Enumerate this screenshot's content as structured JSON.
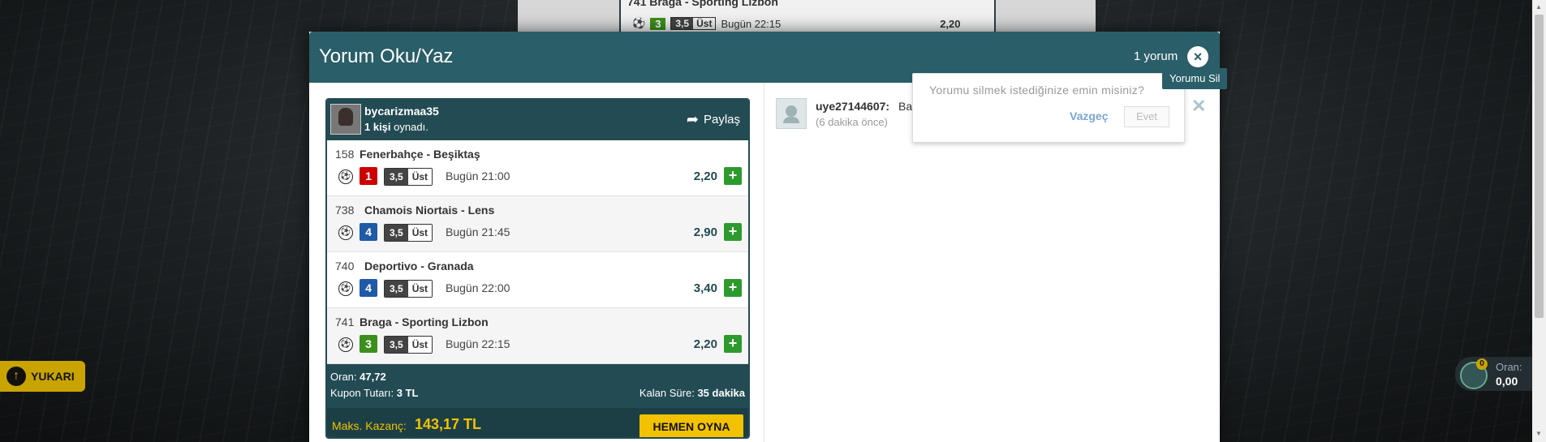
{
  "background": {
    "coupon_row": {
      "id": "741",
      "name": "Braga - Sporting Lizbon",
      "pick": "3",
      "market_a": "3,5",
      "market_b": "Üst",
      "time": "Bugün 22:15",
      "odd": "2,20"
    }
  },
  "left_button": {
    "label": "YUKARI"
  },
  "coupon_widget": {
    "count": "0",
    "label": "Oran:",
    "value": "0,00"
  },
  "modal": {
    "title": "Yorum Oku/Yaz",
    "count": "1 yorum",
    "close_icon": "×"
  },
  "coupon": {
    "username": "bycarizmaa35",
    "played_count": "1 kişi",
    "played_suffix": "oynadı.",
    "share_label": "Paylaş",
    "rows": [
      {
        "id": "158",
        "name": "Fenerbahçe - Beşiktaş",
        "pick": "1",
        "pick_color": "#cc0000",
        "market_a": "3,5",
        "market_b": "Üst",
        "time": "Bugün 21:00",
        "odd": "2,20"
      },
      {
        "id": "738",
        "name": "Chamois Niortais - Lens",
        "pick": "4",
        "pick_color": "#1e5aa8",
        "market_a": "3,5",
        "market_b": "Üst",
        "time": "Bugün 21:45",
        "odd": "2,90"
      },
      {
        "id": "740",
        "name": "Deportivo - Granada",
        "pick": "4",
        "pick_color": "#1e5aa8",
        "market_a": "3,5",
        "market_b": "Üst",
        "time": "Bugün 22:00",
        "odd": "3,40"
      },
      {
        "id": "741",
        "name": "Braga - Sporting Lizbon",
        "pick": "3",
        "pick_color": "#3d8f1d",
        "market_a": "3,5",
        "market_b": "Üst",
        "time": "Bugün 22:15",
        "odd": "2,20"
      }
    ],
    "oran_label": "Oran:",
    "oran_value": "47,72",
    "tutar_label": "Kupon Tutarı:",
    "tutar_value": "3 TL",
    "kalan_label": "Kalan Süre:",
    "kalan_value": "35 dakika",
    "max_label": "Maks. Kazanç:",
    "max_value": "143,17 TL",
    "play_button": "HEMEN OYNA"
  },
  "comment": {
    "user": "uye27144607:",
    "text": "Başarılar...",
    "time": "(6 dakika önce)"
  },
  "confirm": {
    "question": "Yorumu silmek istediğinize emin misiniz?",
    "cancel": "Vazgeç",
    "ok": "Evet",
    "delete_icon": "✕"
  },
  "tooltip": {
    "label": "Yorumu Sil"
  }
}
